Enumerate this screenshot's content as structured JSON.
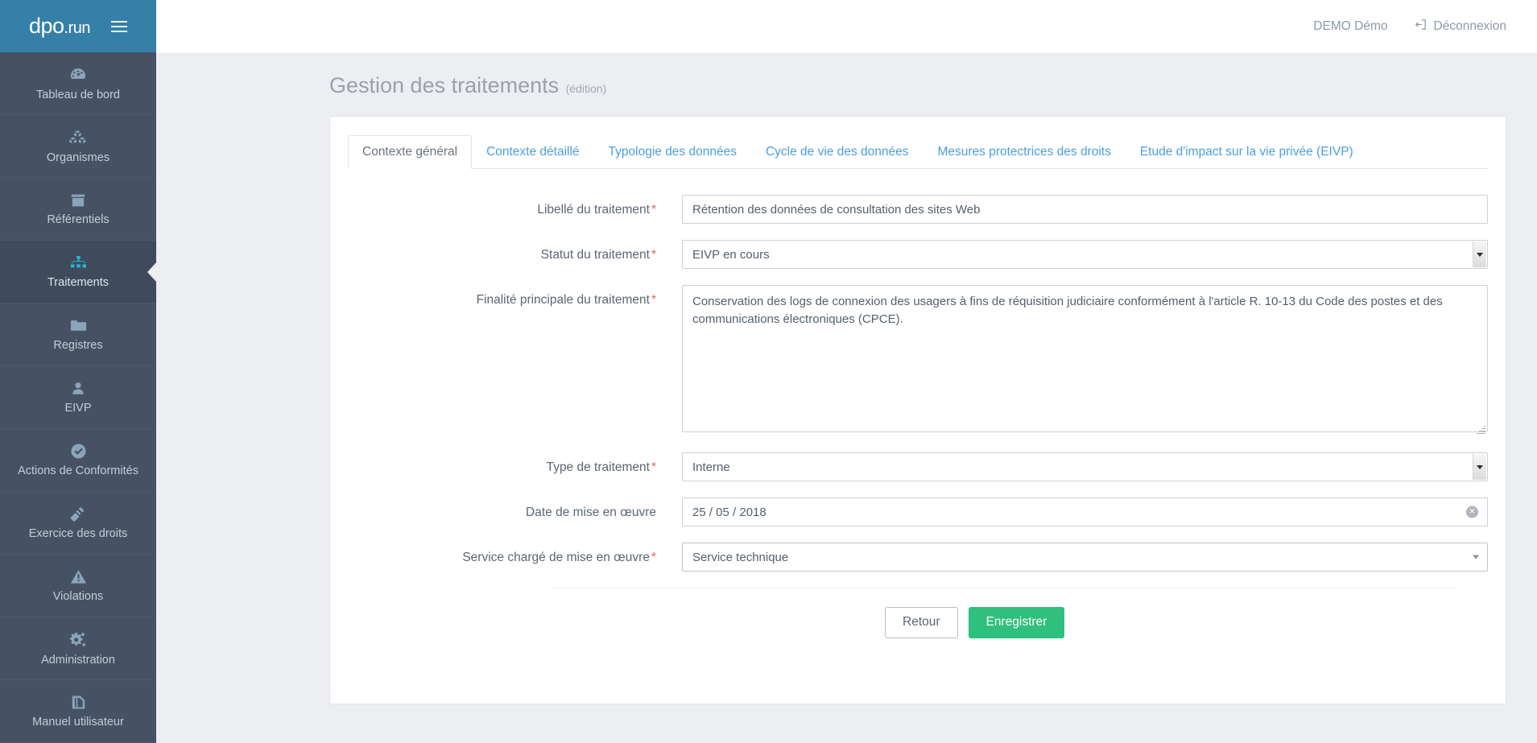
{
  "brand": {
    "logo_main": "dpo",
    "logo_suffix": ".run",
    "menu_icon": "hamburger-icon"
  },
  "sidebar": {
    "items": [
      {
        "label": "Tableau de bord",
        "icon": "dashboard-gauge-icon",
        "active": false
      },
      {
        "label": "Organismes",
        "icon": "cubes-icon",
        "active": false
      },
      {
        "label": "Référentiels",
        "icon": "archive-box-icon",
        "active": false
      },
      {
        "label": "Traitements",
        "icon": "sitemap-icon",
        "active": true
      },
      {
        "label": "Registres",
        "icon": "folder-icon",
        "active": false
      },
      {
        "label": "EIVP",
        "icon": "user-icon",
        "active": false
      },
      {
        "label": "Actions de Conformités",
        "icon": "check-circle-icon",
        "active": false
      },
      {
        "label": "Exercice des droits",
        "icon": "gavel-icon",
        "active": false
      },
      {
        "label": "Violations",
        "icon": "warning-triangle-icon",
        "active": false
      },
      {
        "label": "Administration",
        "icon": "gears-icon",
        "active": false
      },
      {
        "label": "Manuel utilisateur",
        "icon": "book-icon",
        "active": false
      }
    ]
  },
  "topbar": {
    "user": "DEMO Démo",
    "logout_label": "Déconnexion",
    "logout_icon": "sign-out-icon"
  },
  "page": {
    "title": "Gestion des traitements",
    "subtitle": "(édition)"
  },
  "tabs": [
    {
      "label": "Contexte général",
      "active": true
    },
    {
      "label": "Contexte détaillé",
      "active": false
    },
    {
      "label": "Typologie des données",
      "active": false
    },
    {
      "label": "Cycle de vie des données",
      "active": false
    },
    {
      "label": "Mesures protectrices des droits",
      "active": false
    },
    {
      "label": "Etude d'impact sur la vie privée (EIVP)",
      "active": false
    }
  ],
  "form": {
    "required_marker": "*",
    "libelle": {
      "label": "Libellé du traitement",
      "value": "Rétention des données de consultation des sites Web",
      "placeholder": ""
    },
    "statut": {
      "label": "Statut du traitement",
      "value": "EIVP en cours"
    },
    "finalite": {
      "label": "Finalité principale du traitement",
      "value": "Conservation des logs de connexion des usagers à fins de réquisition judiciaire conformément à l'article R. 10-13 du Code des postes et des communications électroniques (CPCE).",
      "placeholder": ""
    },
    "type": {
      "label": "Type de traitement",
      "value": "Interne"
    },
    "date": {
      "label": "Date de mise en œuvre",
      "value": "25 / 05 / 2018",
      "clear_icon": "clear-circle-x-icon"
    },
    "service": {
      "label": "Service chargé de mise en œuvre",
      "value": "Service technique"
    }
  },
  "actions": {
    "back_label": "Retour",
    "save_label": "Enregistrer"
  },
  "colors": {
    "brand_blue": "#3580a8",
    "sidebar": "#465263",
    "sidebar_active": "#3f4a5a",
    "accent_cyan": "#27b3d4",
    "link_blue": "#4a9fe0",
    "success_green": "#2fc07e",
    "required_red": "#e8635e",
    "page_bg": "#eceef2"
  }
}
